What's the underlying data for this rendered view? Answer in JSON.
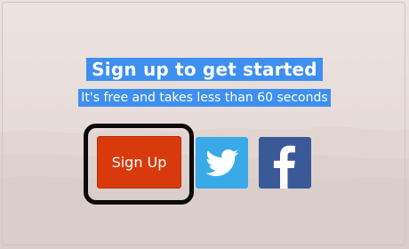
{
  "heading": "Sign up to get started",
  "subheading": "It's free and takes less than 60 seconds",
  "signup_button": "Sign Up",
  "social": [
    {
      "network": "twitter",
      "icon": "twitter-bird-icon",
      "color": "#3aa9e8"
    },
    {
      "network": "facebook",
      "icon": "facebook-f-icon",
      "color": "#3b5999"
    }
  ],
  "colors": {
    "heading_highlight": "#3d8ff0",
    "signup_button": "#d93a0b",
    "focus_ring": "#0a0a0a"
  }
}
